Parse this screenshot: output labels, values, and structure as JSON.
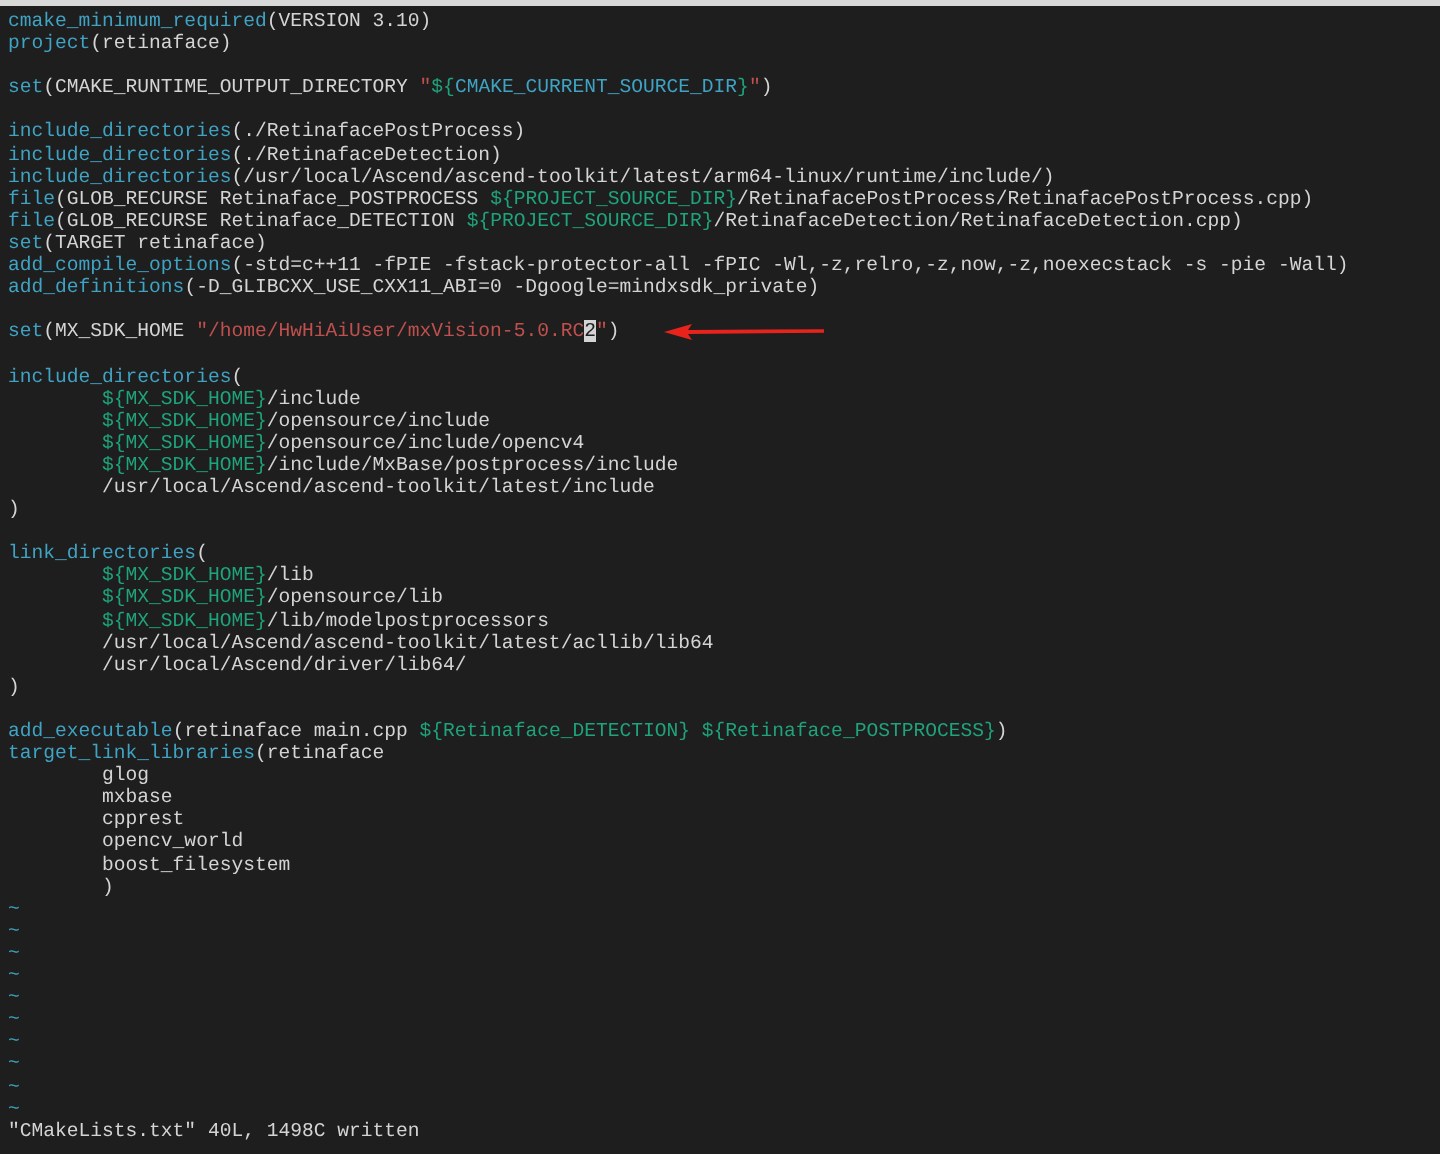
{
  "editor": {
    "lines": [
      {
        "kind": "code",
        "tokens": [
          {
            "kind": "kw",
            "text": "cmake_minimum_required"
          },
          {
            "kind": "plain",
            "text": "(VERSION 3.10)"
          }
        ]
      },
      {
        "kind": "code",
        "tokens": [
          {
            "kind": "kw",
            "text": "project"
          },
          {
            "kind": "plain",
            "text": "(retinaface)"
          }
        ]
      },
      {
        "kind": "blank"
      },
      {
        "kind": "code",
        "tokens": [
          {
            "kind": "kw",
            "text": "set"
          },
          {
            "kind": "plain",
            "text": "(CMAKE_RUNTIME_OUTPUT_DIRECTORY "
          },
          {
            "kind": "str",
            "text": "\""
          },
          {
            "kind": "var",
            "text": "${"
          },
          {
            "kind": "kw",
            "text": "CMAKE_CURRENT_SOURCE_DIR"
          },
          {
            "kind": "var",
            "text": "}"
          },
          {
            "kind": "str",
            "text": "\""
          },
          {
            "kind": "plain",
            "text": ")"
          }
        ]
      },
      {
        "kind": "blank"
      },
      {
        "kind": "code",
        "tokens": [
          {
            "kind": "kw",
            "text": "include_directories"
          },
          {
            "kind": "plain",
            "text": "(./RetinafacePostProcess)"
          }
        ]
      },
      {
        "kind": "code",
        "tokens": [
          {
            "kind": "kw",
            "text": "include_directories"
          },
          {
            "kind": "plain",
            "text": "(./RetinafaceDetection)"
          }
        ]
      },
      {
        "kind": "code",
        "tokens": [
          {
            "kind": "kw",
            "text": "include_directories"
          },
          {
            "kind": "plain",
            "text": "(/usr/local/Ascend/ascend-toolkit/latest/arm64-linux/runtime/include/)"
          }
        ]
      },
      {
        "kind": "code",
        "tokens": [
          {
            "kind": "kw",
            "text": "file"
          },
          {
            "kind": "plain",
            "text": "(GLOB_RECURSE Retinaface_POSTPROCESS "
          },
          {
            "kind": "var",
            "text": "${PROJECT_SOURCE_DIR}"
          },
          {
            "kind": "plain",
            "text": "/RetinafacePostProcess/RetinafacePostProcess.cpp)"
          }
        ]
      },
      {
        "kind": "code",
        "tokens": [
          {
            "kind": "kw",
            "text": "file"
          },
          {
            "kind": "plain",
            "text": "(GLOB_RECURSE Retinaface_DETECTION "
          },
          {
            "kind": "var",
            "text": "${PROJECT_SOURCE_DIR}"
          },
          {
            "kind": "plain",
            "text": "/RetinafaceDetection/RetinafaceDetection.cpp)"
          }
        ]
      },
      {
        "kind": "code",
        "tokens": [
          {
            "kind": "kw",
            "text": "set"
          },
          {
            "kind": "plain",
            "text": "(TARGET retinaface)"
          }
        ]
      },
      {
        "kind": "code",
        "tokens": [
          {
            "kind": "kw",
            "text": "add_compile_options"
          },
          {
            "kind": "plain",
            "text": "(-std=c++11 -fPIE -fstack-protector-all -fPIC -Wl,-z,relro,-z,now,-z,noexecstack -s -pie -Wall)"
          }
        ]
      },
      {
        "kind": "code",
        "tokens": [
          {
            "kind": "kw",
            "text": "add_definitions"
          },
          {
            "kind": "plain",
            "text": "(-D_GLIBCXX_USE_CXX11_ABI=0 -Dgoogle=mindxsdk_private)"
          }
        ]
      },
      {
        "kind": "blank"
      },
      {
        "kind": "code",
        "arrow": true,
        "tokens": [
          {
            "kind": "kw",
            "text": "set"
          },
          {
            "kind": "plain",
            "text": "(MX_SDK_HOME "
          },
          {
            "kind": "str",
            "text": "\"/home/HwHiAiUser/mxVision-5.0.RC"
          },
          {
            "kind": "cursor",
            "text": "2"
          },
          {
            "kind": "str",
            "text": "\""
          },
          {
            "kind": "plain",
            "text": ")"
          }
        ]
      },
      {
        "kind": "blank"
      },
      {
        "kind": "code",
        "tokens": [
          {
            "kind": "kw",
            "text": "include_directories"
          },
          {
            "kind": "plain",
            "text": "("
          }
        ]
      },
      {
        "kind": "code",
        "indented": true,
        "tokens": [
          {
            "kind": "var",
            "text": "${MX_SDK_HOME}"
          },
          {
            "kind": "plain",
            "text": "/include"
          }
        ]
      },
      {
        "kind": "code",
        "indented": true,
        "tokens": [
          {
            "kind": "var",
            "text": "${MX_SDK_HOME}"
          },
          {
            "kind": "plain",
            "text": "/opensource/include"
          }
        ]
      },
      {
        "kind": "code",
        "indented": true,
        "tokens": [
          {
            "kind": "var",
            "text": "${MX_SDK_HOME}"
          },
          {
            "kind": "plain",
            "text": "/opensource/include/opencv4"
          }
        ]
      },
      {
        "kind": "code",
        "indented": true,
        "tokens": [
          {
            "kind": "var",
            "text": "${MX_SDK_HOME}"
          },
          {
            "kind": "plain",
            "text": "/include/MxBase/postprocess/include"
          }
        ]
      },
      {
        "kind": "code",
        "indented": true,
        "tokens": [
          {
            "kind": "plain",
            "text": "/usr/local/Ascend/ascend-toolkit/latest/include"
          }
        ]
      },
      {
        "kind": "code",
        "tokens": [
          {
            "kind": "plain",
            "text": ")"
          }
        ]
      },
      {
        "kind": "blank"
      },
      {
        "kind": "code",
        "tokens": [
          {
            "kind": "kw",
            "text": "link_directories"
          },
          {
            "kind": "plain",
            "text": "("
          }
        ]
      },
      {
        "kind": "code",
        "indented": true,
        "tokens": [
          {
            "kind": "var",
            "text": "${MX_SDK_HOME}"
          },
          {
            "kind": "plain",
            "text": "/lib"
          }
        ]
      },
      {
        "kind": "code",
        "indented": true,
        "tokens": [
          {
            "kind": "var",
            "text": "${MX_SDK_HOME}"
          },
          {
            "kind": "plain",
            "text": "/opensource/lib"
          }
        ]
      },
      {
        "kind": "code",
        "indented": true,
        "tokens": [
          {
            "kind": "var",
            "text": "${MX_SDK_HOME}"
          },
          {
            "kind": "plain",
            "text": "/lib/modelpostprocessors"
          }
        ]
      },
      {
        "kind": "code",
        "indented": true,
        "tokens": [
          {
            "kind": "plain",
            "text": "/usr/local/Ascend/ascend-toolkit/latest/acllib/lib64"
          }
        ]
      },
      {
        "kind": "code",
        "indented": true,
        "tokens": [
          {
            "kind": "plain",
            "text": "/usr/local/Ascend/driver/lib64/"
          }
        ]
      },
      {
        "kind": "code",
        "tokens": [
          {
            "kind": "plain",
            "text": ")"
          }
        ]
      },
      {
        "kind": "blank"
      },
      {
        "kind": "code",
        "tokens": [
          {
            "kind": "kw",
            "text": "add_executable"
          },
          {
            "kind": "plain",
            "text": "(retinaface main.cpp "
          },
          {
            "kind": "var",
            "text": "${Retinaface_DETECTION} "
          },
          {
            "kind": "var",
            "text": "${Retinaface_POSTPROCESS}"
          },
          {
            "kind": "plain",
            "text": ")"
          }
        ]
      },
      {
        "kind": "code",
        "tokens": [
          {
            "kind": "kw",
            "text": "target_link_libraries"
          },
          {
            "kind": "plain",
            "text": "(retinaface"
          }
        ]
      },
      {
        "kind": "code",
        "indented": true,
        "tokens": [
          {
            "kind": "plain",
            "text": "glog"
          }
        ]
      },
      {
        "kind": "code",
        "indented": true,
        "tokens": [
          {
            "kind": "plain",
            "text": "mxbase"
          }
        ]
      },
      {
        "kind": "code",
        "indented": true,
        "tokens": [
          {
            "kind": "plain",
            "text": "cpprest"
          }
        ]
      },
      {
        "kind": "code",
        "indented": true,
        "tokens": [
          {
            "kind": "plain",
            "text": "opencv_world"
          }
        ]
      },
      {
        "kind": "code",
        "indented": true,
        "tokens": [
          {
            "kind": "plain",
            "text": "boost_filesystem"
          }
        ]
      },
      {
        "kind": "code",
        "indented": true,
        "tokens": [
          {
            "kind": "plain",
            "text": ")"
          }
        ]
      }
    ],
    "empty_markers": [
      "~",
      "~",
      "~",
      "~",
      "~",
      "~",
      "~",
      "~",
      "~",
      "~"
    ],
    "status_message": "\"CMakeLists.txt\" 40L, 1498C written"
  }
}
